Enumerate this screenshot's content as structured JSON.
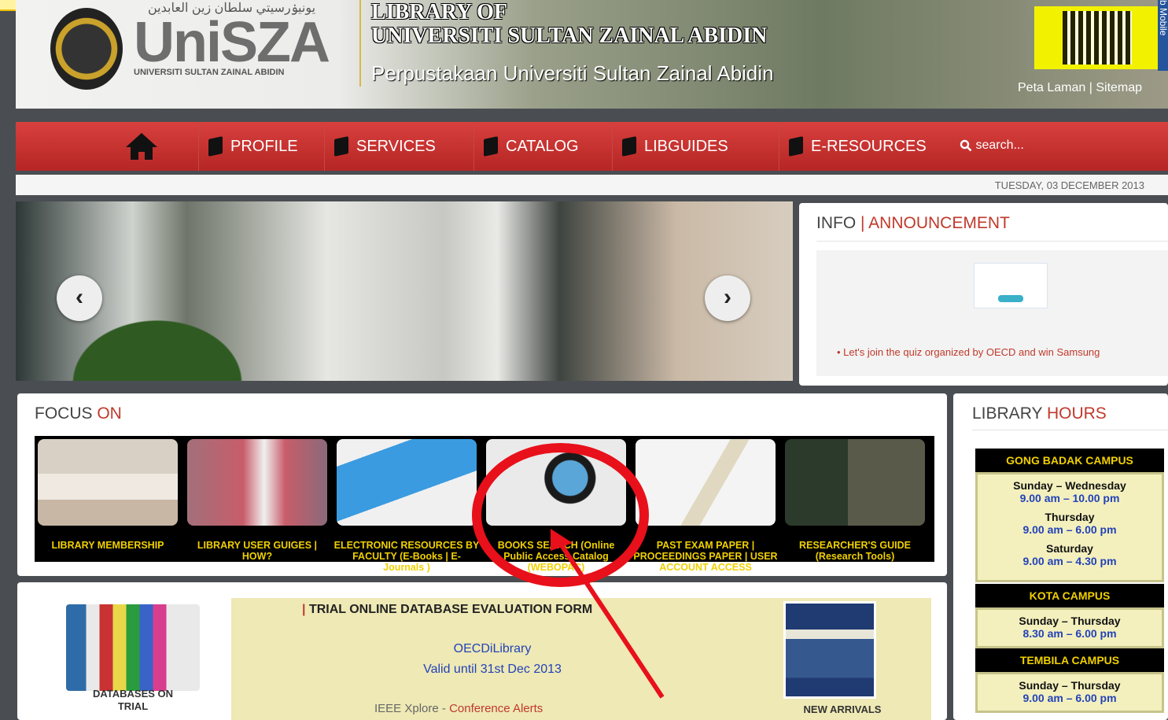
{
  "header": {
    "arabic": "يونيۏرسيتي سلطان زين العابدين",
    "logo_text": "UniSZA",
    "logo_sub": "UNIVERSITI SULTAN ZAINAL ABIDIN",
    "title_line1": "LIBRARY OF",
    "title_line2": "UNIVERSITI SULTAN ZAINAL ABIDIN",
    "title_line3": "Perpustakaan Universiti Sultan Zainal Abidin",
    "peta": "Peta Laman",
    "sitemap": "Sitemap",
    "mobile": "b Mobile"
  },
  "nav": {
    "items": [
      "PROFILE",
      "SERVICES",
      "CATALOG",
      "LIBGUIDES",
      "E-RESOURCES"
    ],
    "search_placeholder": "search..."
  },
  "date": "TUESDAY, 03 DECEMBER 2013",
  "info": {
    "title_a": "INFO",
    "title_sep": "|",
    "title_b": "ANNOUNCEMENT",
    "news": "Let's join the quiz organized by OECD and win Samsung"
  },
  "focus": {
    "title_a": "FOCUS",
    "title_b": "ON",
    "tiles": [
      {
        "label": "LIBRARY MEMBERSHIP"
      },
      {
        "label": "LIBRARY USER GUIGES | HOW?"
      },
      {
        "label": "ELECTRONIC RESOURCES BY FACULTY (E-Books | E-Journals )"
      },
      {
        "label": "BOOKS SEARCH (Online Public Access Catalog (WEBOPAC)"
      },
      {
        "label": "PAST EXAM PAPER | PROCEEDINGS PAPER | USER ACCOUNT ACCESS"
      },
      {
        "label": "RESEARCHER'S GUIDE (Research Tools)"
      }
    ]
  },
  "database": {
    "left_caption": "DATABASES ON TRIAL",
    "heading_bar": "|",
    "heading": "TRIAL ONLINE DATABASE EVALUATION FORM",
    "line1": "OECDiLibrary",
    "line2": "Valid until 31st Dec 2013",
    "line3_a": "IEEE Xplore",
    "line3_sep": " - ",
    "line3_b": "Conference Alerts",
    "right_caption": "NEW ARRIVALS"
  },
  "hours": {
    "title_a": "LIBRARY",
    "title_b": "HOURS",
    "campuses": [
      {
        "name": "GONG BADAK CAMPUS",
        "slots": [
          {
            "day": "Sunday – Wednesday",
            "time": "9.00 am – 10.00 pm"
          },
          {
            "day": "Thursday",
            "time": "9.00 am – 6.00 pm"
          },
          {
            "day": "Saturday",
            "time": "9.00 am – 4.30 pm"
          }
        ]
      },
      {
        "name": "KOTA CAMPUS",
        "slots": [
          {
            "day": "Sunday – Thursday",
            "time": "8.30 am – 6.00 pm"
          }
        ]
      },
      {
        "name": "TEMBILA CAMPUS",
        "slots": [
          {
            "day": "Sunday – Thursday",
            "time": "9.00 am – 6.00 pm"
          }
        ]
      }
    ]
  },
  "colors": {
    "nav_red": "#c0302e",
    "accent_red": "#c0392b",
    "caption_yellow": "#f0d000",
    "annotation_red": "#e8101a"
  },
  "icons": [
    "home-icon",
    "book-icon",
    "search-icon",
    "chevron-left-icon",
    "chevron-right-icon"
  ]
}
